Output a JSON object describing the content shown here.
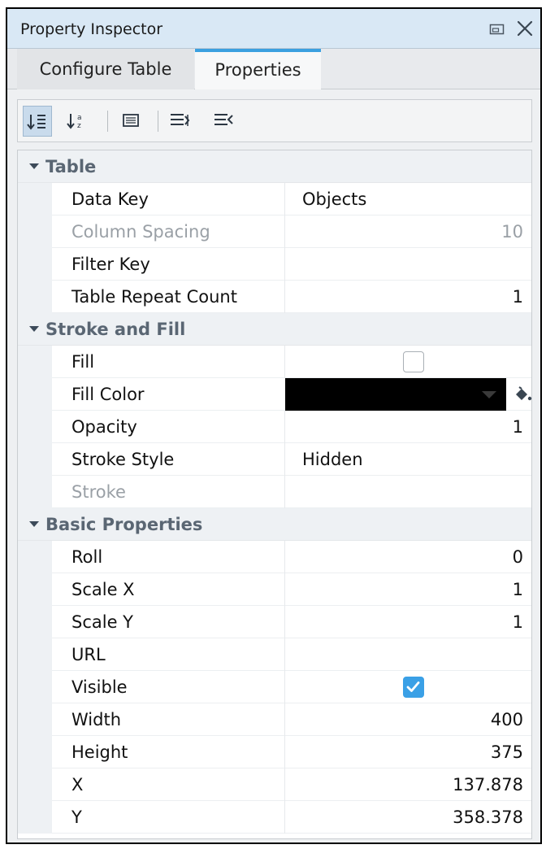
{
  "window": {
    "title": "Property Inspector",
    "restore_icon": "restore-window-icon",
    "close_icon": "close-icon"
  },
  "tabs": [
    {
      "label": "Configure Table",
      "selected": false
    },
    {
      "label": "Properties",
      "selected": true
    }
  ],
  "toolbar": {
    "buttons": [
      {
        "icon": "sort-by-category-icon",
        "active": true
      },
      {
        "icon": "sort-alphabetical-icon",
        "active": false
      },
      {
        "icon": "property-description-icon",
        "active": false
      },
      {
        "icon": "expand-all-icon",
        "active": false
      },
      {
        "icon": "collapse-all-icon",
        "active": false
      }
    ]
  },
  "categories": {
    "table": {
      "label": "Table",
      "rows": {
        "data_key": {
          "name": "Data Key",
          "value": "Objects"
        },
        "column_spacing": {
          "name": "Column Spacing",
          "value": "10"
        },
        "filter_key": {
          "name": "Filter Key",
          "value": ""
        },
        "table_repeat_count": {
          "name": "Table Repeat Count",
          "value": "1"
        }
      }
    },
    "stroke_fill": {
      "label": "Stroke and Fill",
      "rows": {
        "fill": {
          "name": "Fill",
          "checked": false
        },
        "fill_color": {
          "name": "Fill Color",
          "color": "#000000",
          "icon": "paint-bucket-icon"
        },
        "opacity": {
          "name": "Opacity",
          "value": "1"
        },
        "stroke_style": {
          "name": "Stroke Style",
          "value": "Hidden"
        },
        "stroke": {
          "name": "Stroke",
          "value": ""
        }
      }
    },
    "basic": {
      "label": "Basic Properties",
      "rows": {
        "roll": {
          "name": "Roll",
          "value": "0"
        },
        "scale_x": {
          "name": "Scale X",
          "value": "1"
        },
        "scale_y": {
          "name": "Scale Y",
          "value": "1"
        },
        "url": {
          "name": "URL",
          "value": ""
        },
        "visible": {
          "name": "Visible",
          "checked": true
        },
        "width": {
          "name": "Width",
          "value": "400"
        },
        "height": {
          "name": "Height",
          "value": "375"
        },
        "x": {
          "name": "X",
          "value": "137.878"
        },
        "y": {
          "name": "Y",
          "value": "358.378"
        }
      }
    }
  },
  "colors": {
    "accent": "#3ba0e0",
    "checkbox_checked": "#3aa0e6",
    "titlebar": "#d9e8f5"
  }
}
